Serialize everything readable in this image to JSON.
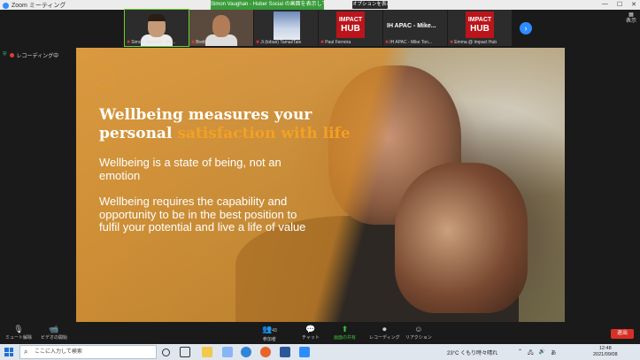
{
  "titlebar": {
    "app_title": "Zoom ミーティング",
    "share_banner": "Simon Vaughan - Huber Social の画面を表示しています",
    "view_options": "オプションを表示",
    "win_minimize": "—",
    "win_maximize": "☐",
    "win_close": "✕"
  },
  "participants": [
    {
      "name": "Simon Vaughan - Hu...",
      "type": "video"
    },
    {
      "name": "Brett Mail/Tel ...",
      "type": "video"
    },
    {
      "name": "Ji (tobari) Tamai/Tale",
      "type": "video"
    },
    {
      "name": "Paul Ferreira",
      "type": "logo",
      "logo_line1": "IMPACT",
      "logo_line2": "HUB"
    },
    {
      "name": "IH APAC - Mike Ton...",
      "type": "text",
      "display": "IH APAC - Mike..."
    },
    {
      "name": "Emma @ Impact Hub",
      "type": "logo",
      "logo_line1": "IMPACT",
      "logo_line2": "HUB"
    }
  ],
  "strip": {
    "next_icon": "chevron-right-icon",
    "view_label": "表示"
  },
  "status": {
    "recording_label": "レコーディング中"
  },
  "slide": {
    "headline_part1": "Wellbeing measures your personal ",
    "headline_highlight": "satisfaction with life",
    "paragraph1": "Wellbeing is a state of being, not an emotion",
    "paragraph2": "Wellbeing requires the capability and opportunity to be in the best position to fulfil your potential and live a life of value",
    "accent_color": "#f3a026"
  },
  "toolbar": {
    "mute": "ミュート解除",
    "video": "ビデオの開始",
    "participants_count": "43",
    "participants": "参加者",
    "chat": "チャット",
    "share": "画面の共有",
    "record": "レコーディング",
    "reactions": "リアクション",
    "end": "退出"
  },
  "taskbar": {
    "search_placeholder": "ここに入力して検索",
    "weather": "23°C くもり時々晴れ",
    "time": "12:48",
    "date": "2021/09/08"
  }
}
